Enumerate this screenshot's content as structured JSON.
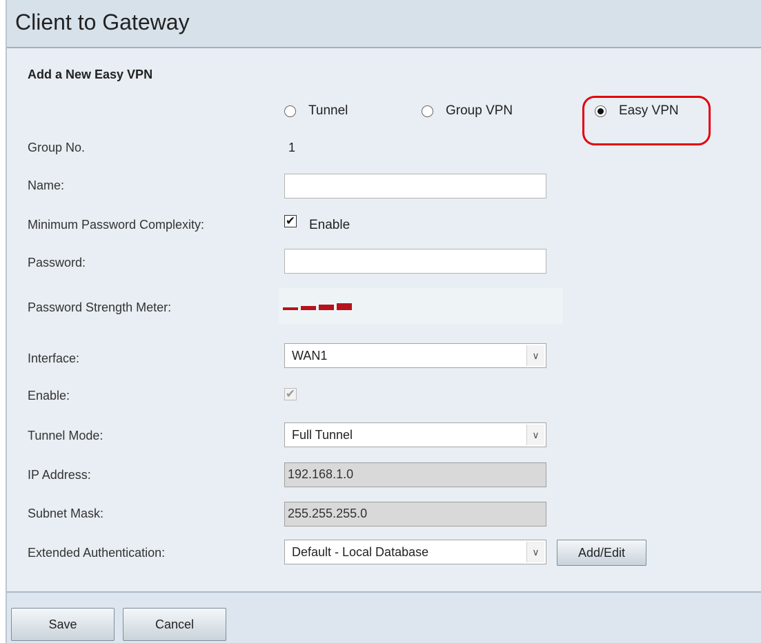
{
  "header": {
    "title": "Client to Gateway"
  },
  "section": {
    "title": "Add a New Easy VPN"
  },
  "vpn_type": {
    "options": [
      {
        "label": "Tunnel",
        "selected": false
      },
      {
        "label": "Group VPN",
        "selected": false
      },
      {
        "label": "Easy VPN",
        "selected": true
      }
    ]
  },
  "form": {
    "group_no": {
      "label": "Group No.",
      "value": "1"
    },
    "name": {
      "label": "Name:",
      "value": ""
    },
    "min_password_complexity": {
      "label": "Minimum Password Complexity:",
      "checkbox_label": "Enable",
      "checked": true
    },
    "password": {
      "label": "Password:",
      "value": ""
    },
    "password_strength": {
      "label": "Password Strength Meter:",
      "color": "#b5121b"
    },
    "interface": {
      "label": "Interface:",
      "value": "WAN1"
    },
    "enable": {
      "label": "Enable:",
      "checked": true,
      "disabled": true
    },
    "tunnel_mode": {
      "label": "Tunnel Mode:",
      "value": "Full Tunnel"
    },
    "ip_address": {
      "label": "IP Address:",
      "value": "192.168.1.0"
    },
    "subnet_mask": {
      "label": "Subnet Mask:",
      "value": "255.255.255.0"
    },
    "extended_auth": {
      "label": "Extended Authentication:",
      "value": "Default - Local Database",
      "button_label": "Add/Edit"
    }
  },
  "footer": {
    "save_label": "Save",
    "cancel_label": "Cancel"
  },
  "colors": {
    "highlight": "#e3000f",
    "background": "#e8eef3"
  }
}
